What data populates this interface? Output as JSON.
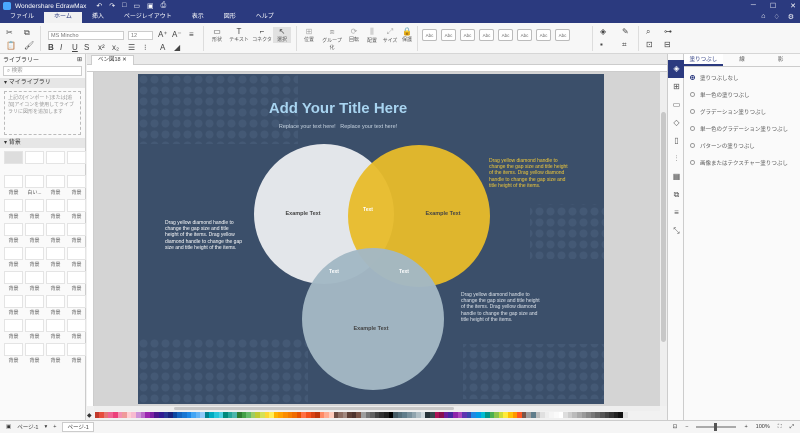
{
  "app": {
    "title": "Wondershare EdrawMax"
  },
  "menu": {
    "tabs": [
      "ファイル",
      "ホーム",
      "挿入",
      "ページレイアウト",
      "表示",
      "図形",
      "ヘルプ"
    ],
    "active": "ホーム"
  },
  "ribbon": {
    "font_name": "MS Mincho",
    "font_size": "12",
    "tools": [
      {
        "icon": "rectangle-icon",
        "label": "形状"
      },
      {
        "icon": "text-icon",
        "label": "テキスト"
      },
      {
        "icon": "connector-icon",
        "label": "コネクタ"
      },
      {
        "icon": "select-icon",
        "label": "選択"
      }
    ],
    "arrange": [
      "位置",
      "グループ化",
      "回転",
      "配置",
      "サイズ",
      "保護"
    ],
    "style_preview": "Abc"
  },
  "library": {
    "title": "ライブラリー",
    "search_placeholder": "検索",
    "my_library": "マイライブラリ",
    "my_library_hint": "上記の[インポート]または[追加]アイコンを使用してライブラリに図形を追加します",
    "background_section": "背景",
    "thumbs": [
      "",
      "",
      "",
      "",
      "背景",
      "白い...",
      "背景",
      "背景",
      "背景",
      "背景",
      "背景",
      "背景",
      "背景",
      "背景",
      "背景",
      "背景",
      "背景",
      "背景",
      "背景",
      "背景",
      "背景",
      "背景",
      "背景",
      "背景",
      "背景",
      "背景",
      "背景",
      "背景",
      "背景",
      "背景",
      "背景",
      "背景",
      "背景",
      "背景",
      "背景",
      "背景"
    ]
  },
  "document": {
    "tab": "ベン図18"
  },
  "diagram": {
    "title": "Add Your Title Here",
    "subtitle": "Replace your text here!   Replace your text here!",
    "circles": [
      {
        "name": "circle-left",
        "label": "Example Text",
        "color": "#e3e6ea"
      },
      {
        "name": "circle-right",
        "label": "Example Text",
        "color": "#e8bc2a"
      },
      {
        "name": "circle-bottom",
        "label": "Example Text",
        "color": "#a3b8c4"
      }
    ],
    "intersections": {
      "top": "Text",
      "left": "Text",
      "right": "Text"
    },
    "note_left": "Drag yellow diamond handle to change the gap size and title height of the items. Drag yellow diamond handle to change the gap size and title height of the items.",
    "note_right": "Drag yellow diamond handle to change the gap size and title height of the items. Drag yellow diamond handle to change the gap size and title height of the items.",
    "note_bottom": "Drag yellow diamond handle to change the gap size and title height of the items. Drag yellow diamond handle to change the gap size and title height of the items."
  },
  "fill_panel": {
    "tabs": [
      "塗りつぶし",
      "線",
      "影"
    ],
    "options": [
      "塗りつぶしなし",
      "単一色の塗りつぶし",
      "グラデーション塗りつぶし",
      "単一色のグラデーション塗りつぶし",
      "パターンの塗りつぶし",
      "画像またはテクスチャー塗りつぶし"
    ],
    "selected": 0
  },
  "status": {
    "page_selector": "ページ-1",
    "page_tab": "ページ-1",
    "zoom": "100%"
  },
  "palette": [
    "#c0392b",
    "#e74c3c",
    "#e57373",
    "#f06292",
    "#ec407a",
    "#f48fb1",
    "#ef9a9a",
    "#ffcdd2",
    "#f8bbd0",
    "#ce93d8",
    "#ba68c8",
    "#9c27b0",
    "#7b1fa2",
    "#4a148c",
    "#311b92",
    "#283593",
    "#1a237e",
    "#0d47a1",
    "#1565c0",
    "#1976d2",
    "#1e88e5",
    "#42a5f5",
    "#64b5f6",
    "#90caf9",
    "#00838f",
    "#00acc1",
    "#26c6da",
    "#4dd0e1",
    "#00897b",
    "#26a69a",
    "#4db6ac",
    "#2e7d32",
    "#43a047",
    "#66bb6a",
    "#9ccc65",
    "#c0ca33",
    "#d4e157",
    "#fdd835",
    "#ffee58",
    "#ffb300",
    "#ffa000",
    "#fb8c00",
    "#f57c00",
    "#ef6c00",
    "#e65100",
    "#ff7043",
    "#f4511e",
    "#d84315",
    "#bf360c",
    "#ff8a65",
    "#ffab91",
    "#ffccbc",
    "#6d4c41",
    "#8d6e63",
    "#a1887f",
    "#5d4037",
    "#4e342e",
    "#795548",
    "#9e9e9e",
    "#757575",
    "#616161",
    "#424242",
    "#303030",
    "#212121",
    "#000000",
    "#455a64",
    "#546e7a",
    "#607d8b",
    "#78909c",
    "#90a4ae",
    "#b0bec5",
    "#cfd8dc",
    "#263238",
    "#37474f",
    "#ad1457",
    "#880e4f",
    "#6a1b9a",
    "#4527a0",
    "#8e24aa",
    "#ab47bc",
    "#5e35b1",
    "#3949ab",
    "#1e88e5",
    "#039be5",
    "#00bcd4",
    "#009688",
    "#4caf50",
    "#8bc34a",
    "#cddc39",
    "#ffeb3b",
    "#ffc107",
    "#ff9800",
    "#ff5722",
    "#795548",
    "#9e9e9e",
    "#607d8b",
    "#bdbdbd",
    "#e0e0e0",
    "#eeeeee",
    "#f5f5f5",
    "#fafafa",
    "#ffffff",
    "#dddddd",
    "#cccccc",
    "#bbbbbb",
    "#aaaaaa",
    "#999999",
    "#888888",
    "#777777",
    "#666666",
    "#555555",
    "#444444",
    "#333333",
    "#222222",
    "#111111",
    "#e0e0e0"
  ]
}
